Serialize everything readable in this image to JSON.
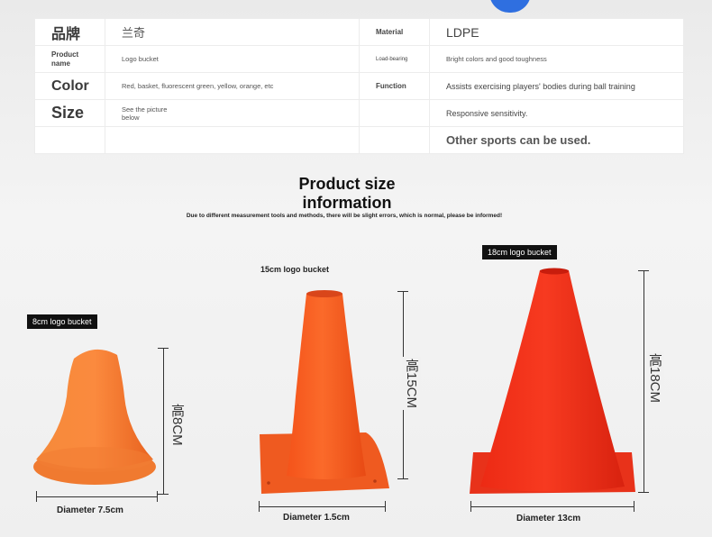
{
  "specs": {
    "rows": [
      {
        "k1": "品牌",
        "v1": "兰奇",
        "k2": "Material",
        "v2": "LDPE"
      },
      {
        "k1": "Product name",
        "v1": "Logo bucket",
        "k2": "Load-bearing",
        "v2": "Bright colors and good toughness"
      },
      {
        "k1": "Color",
        "v1": "Red, basket, fluorescent green, yellow, orange, etc",
        "k2": "Function",
        "v2": "Assists exercising players' bodies during ball training"
      },
      {
        "k1": "Size",
        "v1": "See the picture below",
        "k2": "",
        "v2": "Responsive sensitivity."
      },
      {
        "k1": "",
        "v1": "",
        "k2": "",
        "v2": "Other sports can be used."
      }
    ]
  },
  "heading": {
    "line1": "Product size",
    "line2": "information",
    "note": "Due to different measurement tools and methods, there will be slight errors, which is normal, please be informed!"
  },
  "cones": [
    {
      "label": "8cm logo bucket",
      "height_text": "高8CM",
      "diameter_text": "Diameter 7.5cm",
      "color": "#f7732a",
      "height_cm": 8
    },
    {
      "label": "15cm logo bucket",
      "height_text": "高15CM",
      "diameter_text": "Diameter 1.5cm",
      "color": "#f45a1c",
      "height_cm": 15
    },
    {
      "label": "18cm logo bucket",
      "height_text": "高18CM",
      "diameter_text": "Diameter 13cm",
      "color": "#ef2b16",
      "height_cm": 18
    }
  ],
  "colors": {
    "brand_blue": "#2f6fe0"
  }
}
